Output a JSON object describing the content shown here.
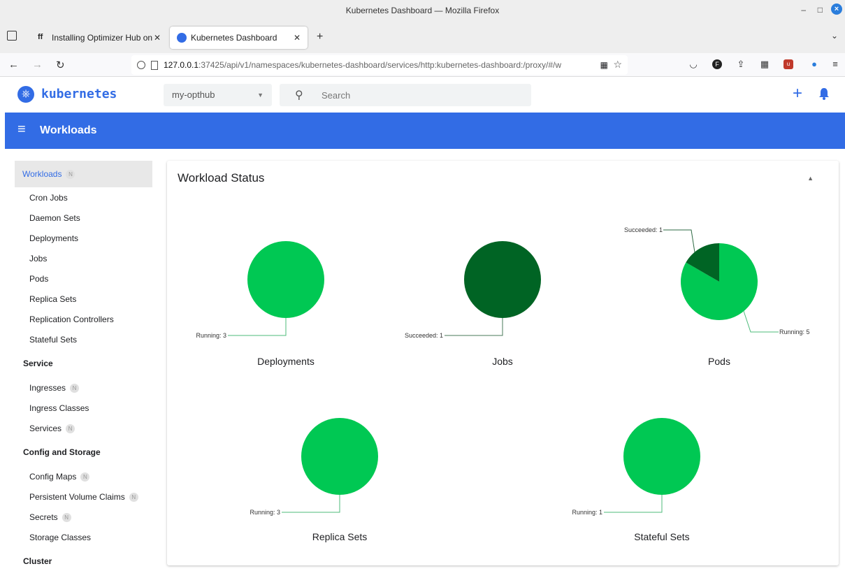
{
  "window": {
    "title": "Kubernetes Dashboard — Mozilla Firefox"
  },
  "browser": {
    "tabs": [
      {
        "label": "Installing Optimizer Hub on"
      },
      {
        "label": "Kubernetes Dashboard"
      }
    ],
    "url_host": "127.0.0.1",
    "url_path": ":37425/api/v1/namespaces/kubernetes-dashboard/services/http:kubernetes-dashboard:/proxy/#/w"
  },
  "app": {
    "brand": "kubernetes",
    "namespace": "my-opthub",
    "search_placeholder": "Search",
    "toolbar_title": "Workloads"
  },
  "sidebar": {
    "active": {
      "label": "Workloads",
      "badge": "N"
    },
    "items": [
      {
        "label": "Cron Jobs"
      },
      {
        "label": "Daemon Sets"
      },
      {
        "label": "Deployments"
      },
      {
        "label": "Jobs"
      },
      {
        "label": "Pods"
      },
      {
        "label": "Replica Sets"
      },
      {
        "label": "Replication Controllers"
      },
      {
        "label": "Stateful Sets"
      }
    ],
    "service_head": "Service",
    "service_items": [
      {
        "label": "Ingresses",
        "badge": "N"
      },
      {
        "label": "Ingress Classes"
      },
      {
        "label": "Services",
        "badge": "N"
      }
    ],
    "config_head": "Config and Storage",
    "config_items": [
      {
        "label": "Config Maps",
        "badge": "N"
      },
      {
        "label": "Persistent Volume Claims",
        "badge": "N"
      },
      {
        "label": "Secrets",
        "badge": "N"
      },
      {
        "label": "Storage Classes"
      }
    ],
    "cluster_head": "Cluster"
  },
  "card": {
    "title": "Workload Status"
  },
  "colors": {
    "running": "#00c853",
    "succeeded": "#006424",
    "accent": "#326ce5"
  },
  "chart_data": [
    {
      "type": "pie",
      "title": "Deployments",
      "slices": [
        {
          "label": "Running",
          "value": 3
        }
      ]
    },
    {
      "type": "pie",
      "title": "Jobs",
      "slices": [
        {
          "label": "Succeeded",
          "value": 1
        }
      ]
    },
    {
      "type": "pie",
      "title": "Pods",
      "slices": [
        {
          "label": "Running",
          "value": 5
        },
        {
          "label": "Succeeded",
          "value": 1
        }
      ]
    },
    {
      "type": "pie",
      "title": "Replica Sets",
      "slices": [
        {
          "label": "Running",
          "value": 3
        }
      ]
    },
    {
      "type": "pie",
      "title": "Stateful Sets",
      "slices": [
        {
          "label": "Running",
          "value": 1
        }
      ]
    }
  ]
}
